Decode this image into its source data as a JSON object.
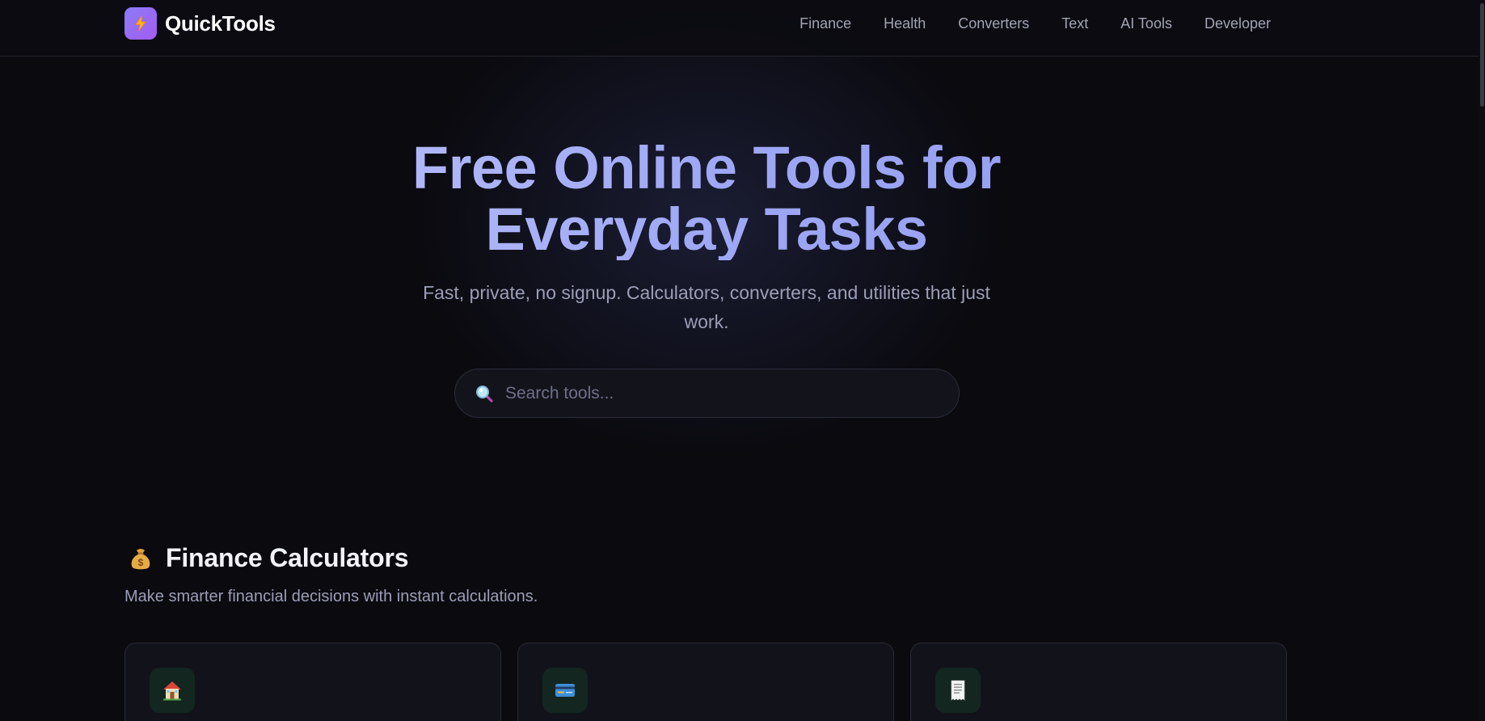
{
  "header": {
    "brand_name": "QuickTools",
    "nav": [
      {
        "label": "Finance"
      },
      {
        "label": "Health"
      },
      {
        "label": "Converters"
      },
      {
        "label": "Text"
      },
      {
        "label": "AI Tools"
      },
      {
        "label": "Developer"
      }
    ]
  },
  "hero": {
    "title_line1": "Free Online Tools for",
    "title_line2": "Everyday Tasks",
    "subtitle": "Fast, private, no signup. Calculators, converters, and utilities that just work.",
    "search_placeholder": "Search tools..."
  },
  "finance_section": {
    "icon": "money-bag-icon",
    "title": "Finance Calculators",
    "description": "Make smarter financial decisions with instant calculations.",
    "cards": [
      {
        "icon": "house-icon"
      },
      {
        "icon": "credit-card-icon"
      },
      {
        "icon": "receipt-icon"
      }
    ]
  },
  "colors": {
    "background": "#0a0a0f",
    "accent_gradient_start": "#8b7bf7",
    "accent_gradient_end": "#a35cf0",
    "hero_text": "#a7b0f7",
    "muted_text": "#9c9eb8",
    "card_bg": "#12121a",
    "card_icon_bg": "#132620"
  }
}
